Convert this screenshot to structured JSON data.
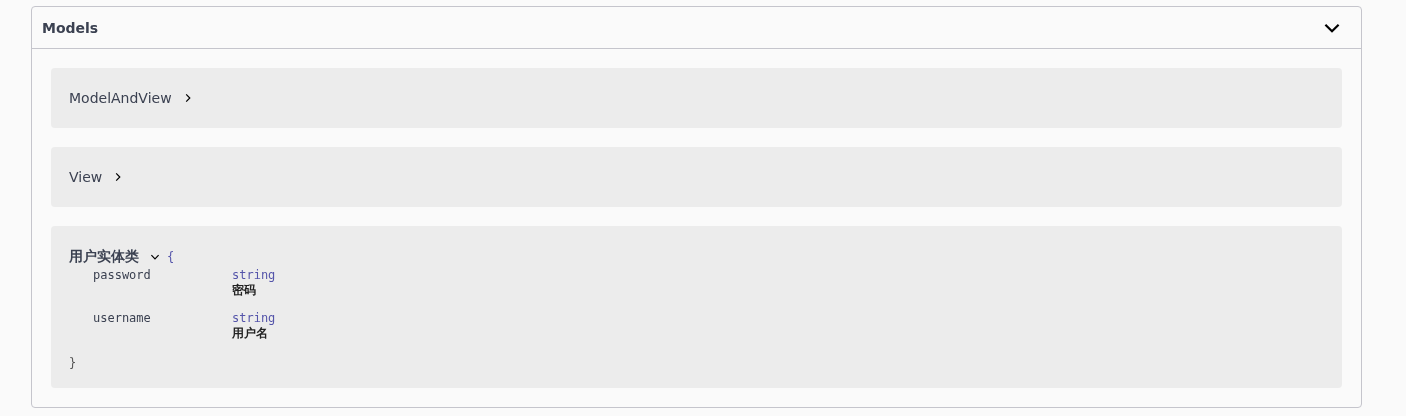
{
  "section": {
    "title": "Models",
    "expanded": true
  },
  "models": [
    {
      "name": "ModelAndView",
      "expanded": false
    },
    {
      "name": "View",
      "expanded": false
    },
    {
      "name": "用户实体类",
      "expanded": true,
      "open_brace": "{",
      "close_brace": "}",
      "properties": [
        {
          "name": "password",
          "type": "string",
          "description": "密码"
        },
        {
          "name": "username",
          "type": "string",
          "description": "用户名"
        }
      ]
    }
  ]
}
